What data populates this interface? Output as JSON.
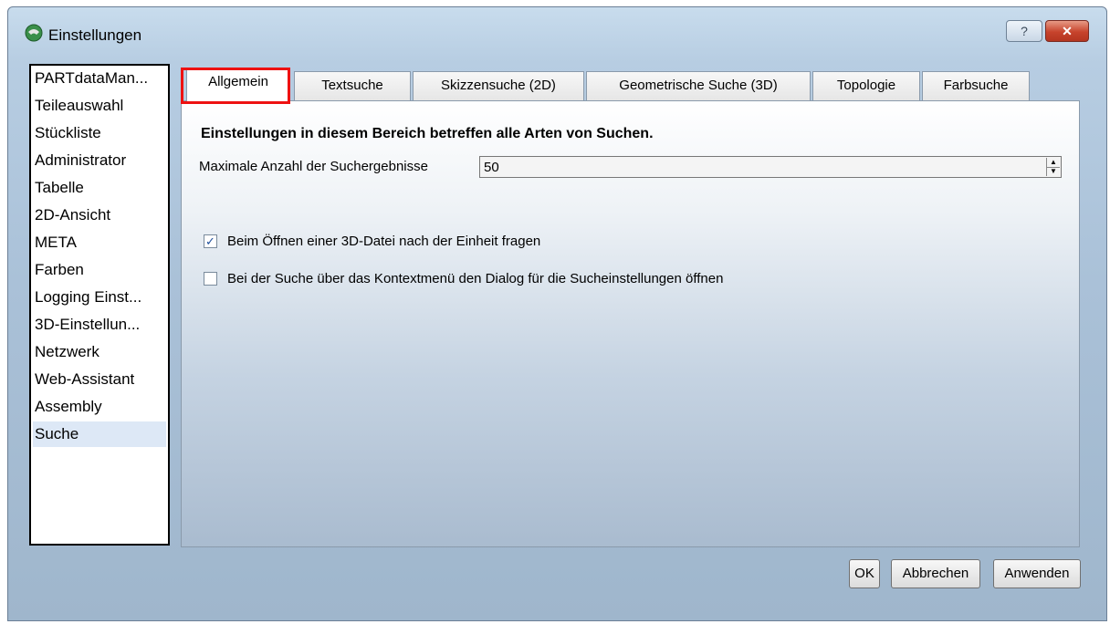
{
  "window": {
    "title": "Einstellungen",
    "help_label": "?",
    "close_label": "✕"
  },
  "sidebar": {
    "items": [
      {
        "label": "PARTdataMan..."
      },
      {
        "label": "Teileauswahl"
      },
      {
        "label": "Stückliste"
      },
      {
        "label": "Administrator"
      },
      {
        "label": "Tabelle"
      },
      {
        "label": "2D-Ansicht"
      },
      {
        "label": "META"
      },
      {
        "label": "Farben"
      },
      {
        "label": "Logging Einst..."
      },
      {
        "label": "3D-Einstellun..."
      },
      {
        "label": "Netzwerk"
      },
      {
        "label": "Web-Assistant"
      },
      {
        "label": "Assembly"
      },
      {
        "label": "Suche"
      }
    ],
    "selected": "Suche"
  },
  "tabs": [
    {
      "label": "Allgemein"
    },
    {
      "label": "Textsuche"
    },
    {
      "label": "Skizzensuche (2D)"
    },
    {
      "label": "Geometrische Suche (3D)"
    },
    {
      "label": "Topologie"
    },
    {
      "label": "Farbsuche"
    }
  ],
  "panel": {
    "heading": "Einstellungen in diesem Bereich betreffen alle Arten von Suchen.",
    "max_results_label": "Maximale Anzahl der Suchergebnisse",
    "max_results_value": "50",
    "spin_up": "▲",
    "spin_down": "▼",
    "options": [
      {
        "label": "Beim Öffnen einer 3D-Datei nach der Einheit fragen",
        "checked": true,
        "mark": "✓"
      },
      {
        "label": "Bei der Suche über das Kontextmenü den Dialog für die Sucheinstellungen öffnen",
        "checked": false,
        "mark": ""
      }
    ]
  },
  "buttons": {
    "ok": "OK",
    "cancel": "Abbrechen",
    "apply": "Anwenden"
  },
  "colors": {
    "highlight": "#ee1111",
    "close": "#c7432c"
  }
}
